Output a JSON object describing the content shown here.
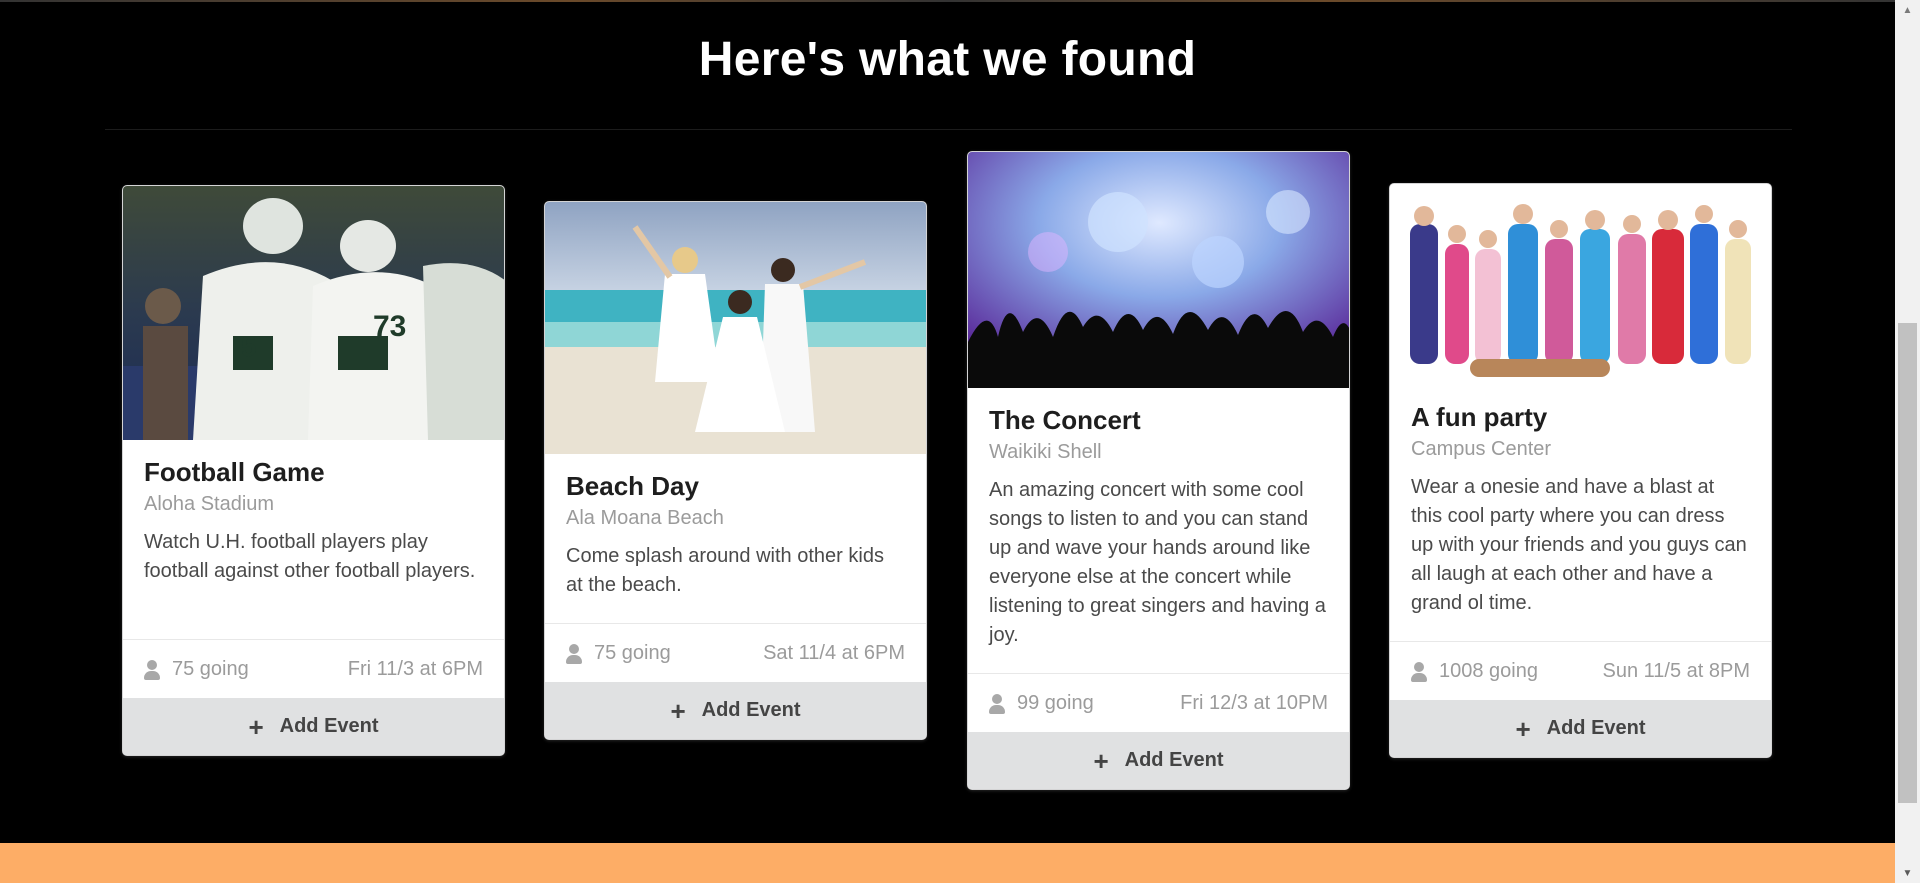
{
  "section": {
    "heading": "Here's what we found"
  },
  "cards": [
    {
      "image": "football-players-photo",
      "title": "Football Game",
      "location": "Aloha Stadium",
      "description": "Watch U.H. football players play football against other football players.",
      "going": "75 going",
      "datetime": "Fri 11/3 at 6PM",
      "button_label": "Add Event"
    },
    {
      "image": "beach-dancers-photo",
      "title": "Beach Day",
      "location": "Ala Moana Beach",
      "description": "Come splash around with other kids at the beach.",
      "going": "75 going",
      "datetime": "Sat 11/4 at 6PM",
      "button_label": "Add Event"
    },
    {
      "image": "concert-crowd-photo",
      "title": "The Concert",
      "location": "Waikiki Shell",
      "description": "An amazing concert with some cool songs to listen to and you can stand up and wave your hands around like everyone else at the concert while listening to great singers and having a joy.",
      "going": "99 going",
      "datetime": "Fri 12/3 at 10PM",
      "button_label": "Add Event"
    },
    {
      "image": "onesie-party-photo",
      "title": "A fun party",
      "location": "Campus Center",
      "description": "Wear a onesie and have a blast at this cool party where you can dress up with your friends and you guys can all laugh at each other and have a grand ol time.",
      "going": "1008 going",
      "datetime": "Sun 11/5 at 8PM",
      "button_label": "Add Event"
    }
  ],
  "colors": {
    "page_background": "#000000",
    "footer_band": "#fdad66",
    "button_background": "#e0e1e2"
  }
}
